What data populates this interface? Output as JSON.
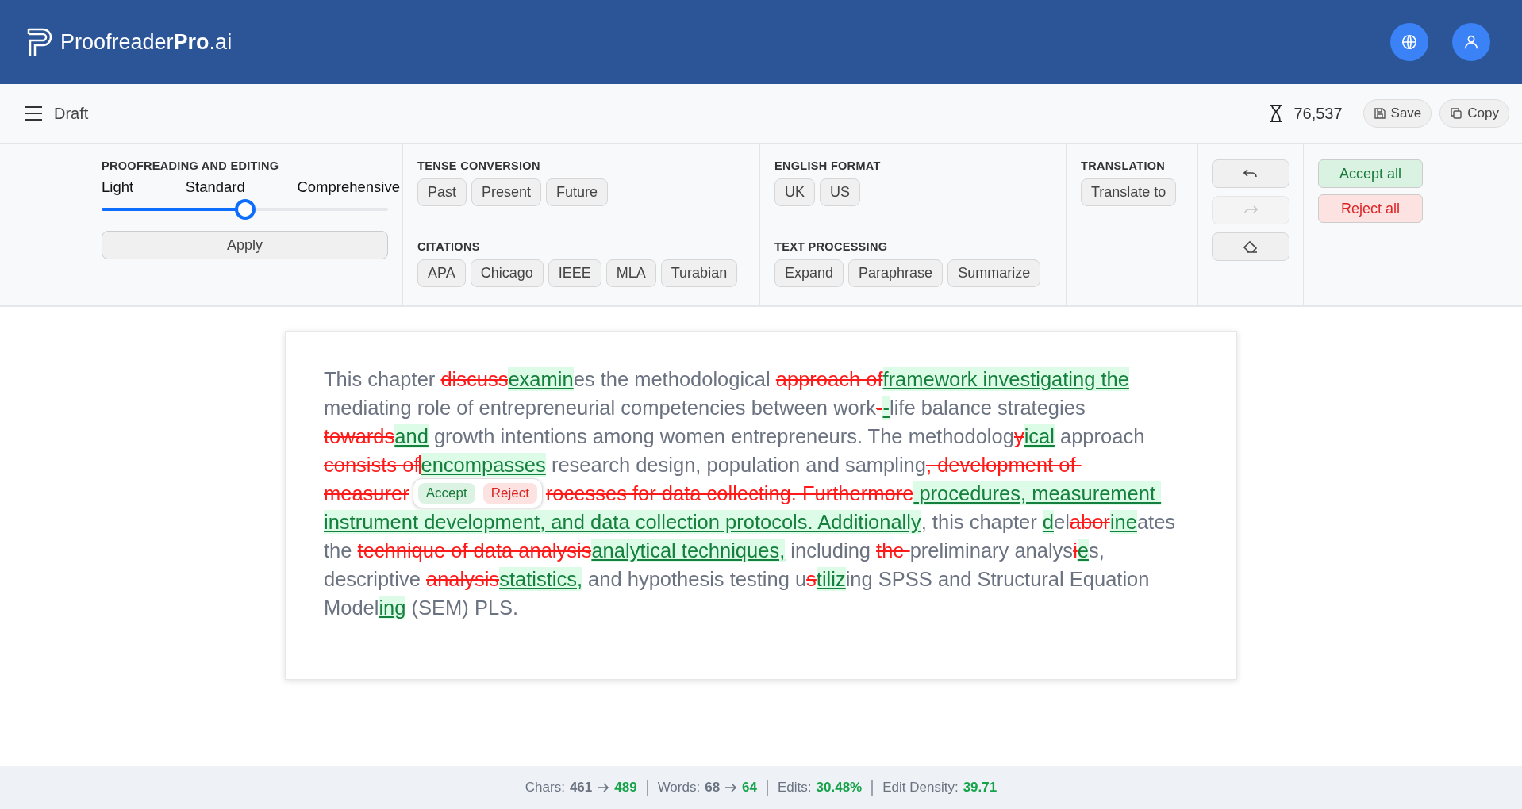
{
  "header": {
    "logo": "Proofreader**Pro**.ai"
  },
  "toolbar": {
    "title": "Draft",
    "credits": "76,537",
    "buttons": [
      {
        "kind": "save",
        "label": "Save"
      },
      {
        "kind": "copy",
        "label": "Copy"
      }
    ]
  },
  "proofreading": {
    "title": "PROOFREADING AND EDITING",
    "levels": [
      "Light",
      "Standard",
      "Comprehensive"
    ],
    "level": 0.5,
    "apply": "Apply"
  },
  "groups": [
    {
      "title": "TENSE CONVERSION",
      "options": [
        "Past",
        "Present",
        "Future"
      ]
    },
    {
      "title": "ENGLISH FORMAT",
      "options": [
        "UK",
        "US"
      ]
    },
    {
      "title": "CITATIONS",
      "options": [
        "APA",
        "Chicago",
        "IEEE",
        "MLA",
        "Turabian"
      ]
    },
    {
      "title": "TEXT PROCESSING",
      "options": [
        "Expand",
        "Paraphrase",
        "Summarize"
      ]
    }
  ],
  "translation": {
    "title": "TRANSLATION",
    "button": "Translate to"
  },
  "history": [
    {
      "kind": "undo",
      "disabled": false
    },
    {
      "kind": "redo",
      "disabled": true
    },
    {
      "kind": "erase",
      "disabled": false
    }
  ],
  "bulk": {
    "accept": "Accept all",
    "reject": "Reject all"
  },
  "lines": [
    [
      {
        "kind": "plain",
        "text": "This chapter "
      },
      {
        "kind": "del",
        "text": "discuss"
      },
      {
        "kind": "ins",
        "text": "examin"
      },
      {
        "kind": "plain",
        "text": "es the methodological "
      },
      {
        "kind": "del",
        "text": "approach of"
      },
      {
        "kind": "ins",
        "text": "framework investigating the"
      }
    ],
    [
      {
        "kind": "plain",
        "text": "mediating role of entrepreneurial competencies between work"
      },
      {
        "kind": "del",
        "text": "-"
      },
      {
        "kind": "ins",
        "text": "-"
      },
      {
        "kind": "plain",
        "text": "life balance strategies"
      }
    ],
    [
      {
        "kind": "del",
        "text": "towards"
      },
      {
        "kind": "ins",
        "text": "and"
      },
      {
        "kind": "plain",
        "text": " growth intentions among women entrepreneurs. The methodolog"
      },
      {
        "kind": "del",
        "text": "y"
      },
      {
        "kind": "ins",
        "text": "ical"
      },
      {
        "kind": "plain",
        "text": " approach"
      }
    ],
    [
      {
        "kind": "del",
        "text": "consists of"
      },
      {
        "kind": "cursor"
      },
      {
        "kind": "ins",
        "text": "encompasses"
      },
      {
        "kind": "plain",
        "text": " research design, population and sampling"
      },
      {
        "kind": "del",
        "text": ", development of "
      }
    ],
    [
      {
        "kind": "del",
        "text": "measurer"
      },
      {
        "kind": "popup",
        "accept": "Accept",
        "reject": "Reject"
      },
      {
        "kind": "del",
        "text": "rocesses for data collecting. Furthermore"
      },
      {
        "kind": "ins",
        "text": " procedures, measurement "
      }
    ],
    [
      {
        "kind": "ins",
        "text": "instrument development, and data collection protocols. Additionally"
      },
      {
        "kind": "plain",
        "text": ", this chapter "
      },
      {
        "kind": "ins",
        "text": "d"
      },
      {
        "kind": "plain",
        "text": "el"
      },
      {
        "kind": "del",
        "text": "abor"
      },
      {
        "kind": "ins",
        "text": "ine"
      },
      {
        "kind": "plain",
        "text": "ates"
      }
    ],
    [
      {
        "kind": "plain",
        "text": "the "
      },
      {
        "kind": "del",
        "text": "technique of data analysis"
      },
      {
        "kind": "ins",
        "text": "analytical techniques,"
      },
      {
        "kind": "plain",
        "text": " including "
      },
      {
        "kind": "del",
        "text": "the "
      },
      {
        "kind": "plain",
        "text": "preliminary analys"
      },
      {
        "kind": "del",
        "text": "i"
      },
      {
        "kind": "ins",
        "text": "e"
      },
      {
        "kind": "plain",
        "text": "s,"
      }
    ],
    [
      {
        "kind": "plain",
        "text": "descriptive "
      },
      {
        "kind": "del",
        "text": "analysis"
      },
      {
        "kind": "ins",
        "text": "statistics,"
      },
      {
        "kind": "plain",
        "text": " and hypothesis testing u"
      },
      {
        "kind": "del",
        "text": "s"
      },
      {
        "kind": "ins",
        "text": "tiliz"
      },
      {
        "kind": "plain",
        "text": "ing SPSS and Structural Equation"
      }
    ],
    [
      {
        "kind": "plain",
        "text": "Model"
      },
      {
        "kind": "ins",
        "text": "ing"
      },
      {
        "kind": "plain",
        "text": " (SEM) PLS."
      }
    ]
  ],
  "stats": [
    {
      "label": "Chars:",
      "from": "461",
      "to": "489"
    },
    {
      "label": "Words:",
      "from": "68",
      "to": "64"
    },
    {
      "label": "Edits:",
      "to": "30.48%"
    },
    {
      "label": "Edit Density:",
      "to": "39.71"
    }
  ]
}
